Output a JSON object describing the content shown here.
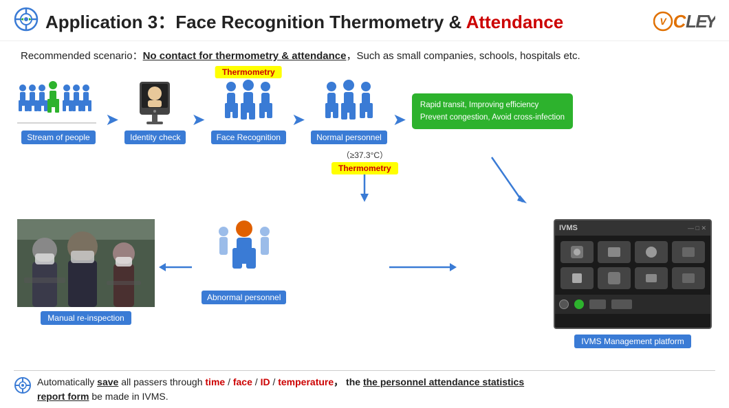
{
  "header": {
    "icon_label": "target-icon",
    "title_prefix": "Application 3：",
    "title_main": "Face Recognition Thermometry & ",
    "title_highlight": "Attendance",
    "logo": "VCLEY"
  },
  "scenario": {
    "label": "Recommended scenario：",
    "highlight": "No contact for thermometry & attendance",
    "rest": "，Such as small companies, schools, hospitals etc."
  },
  "flow": {
    "nodes": [
      {
        "id": "stream",
        "label": "Stream of people"
      },
      {
        "id": "identity",
        "label": "Identity check"
      },
      {
        "id": "face",
        "label": "Face Recognition",
        "badge": "Thermometry"
      },
      {
        "id": "normal",
        "label": "Normal personnel"
      }
    ],
    "green_box_line1": "Rapid transit, Improving efficiency",
    "green_box_line2": "Prevent congestion, Avoid cross-infection",
    "thermo_temp": "（≥37.3°C）",
    "thermo_label": "Thermometry",
    "abnormal_label": "Abnormal personnel",
    "manual_label": "Manual re-inspection",
    "ivms_label": "IVMS Management platform",
    "ivms_header_text": "IVMS"
  },
  "bottom": {
    "icon_label": "refresh-icon",
    "text_auto": "Automatically ",
    "text_save": "save",
    "text_all": " all passers through ",
    "text_time": "time",
    "sep1": " / ",
    "text_face": "face",
    "sep2": " / ",
    "text_id": "ID",
    "sep3": " / ",
    "text_temperature": "temperature",
    "comma": "，  the ",
    "text_stats": "the personnel attendance statistics",
    "text_report": "report form",
    "text_end": " be made in IVMS."
  }
}
